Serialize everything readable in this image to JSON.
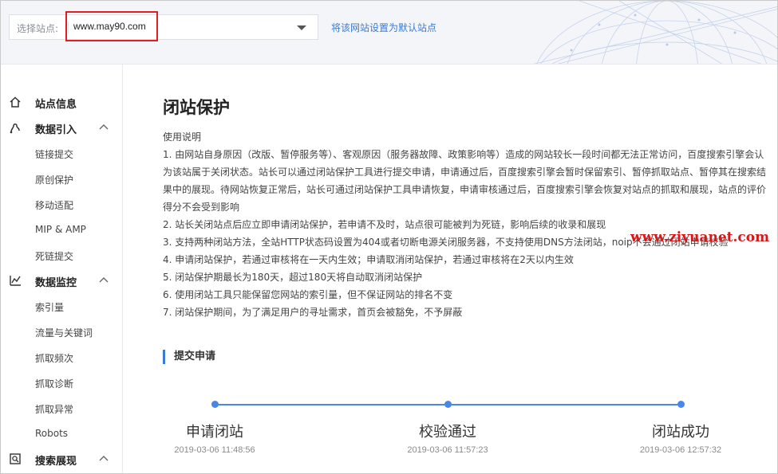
{
  "header": {
    "site_label": "选择站点:",
    "site_value": "www.may90.com",
    "default_link": "将该网站设置为默认站点"
  },
  "sidebar": {
    "items": [
      {
        "label": "站点信息",
        "icon": "home-icon"
      },
      {
        "label": "数据引入",
        "icon": "data-import-icon"
      },
      {
        "label": "数据监控",
        "icon": "chart-icon"
      },
      {
        "label": "搜索展现",
        "icon": "search-display-icon"
      }
    ],
    "sub_import": [
      "链接提交",
      "原创保护",
      "移动适配",
      "MIP & AMP",
      "死链提交"
    ],
    "sub_monitor": [
      "索引量",
      "流量与关键词",
      "抓取频次",
      "抓取诊断",
      "抓取异常",
      "Robots"
    ]
  },
  "main": {
    "title": "闭站保护",
    "usage_title": "使用说明",
    "rules": [
      "1. 由网站自身原因（改版、暂停服务等）、客观原因（服务器故障、政策影响等）造成的网站较长一段时间都无法正常访问，百度搜索引擎会认为该站属于关闭状态。站长可以通过闭站保护工具进行提交申请，申请通过后，百度搜索引擎会暂时保留索引、暂停抓取站点、暂停其在搜索结果中的展现。待网站恢复正常后，站长可通过闭站保护工具申请恢复，申请审核通过后，百度搜索引擎会恢复对站点的抓取和展现，站点的评价得分不会受到影响",
      "2. 站长关闭站点后应立即申请闭站保护，若申请不及时，站点很可能被判为死链，影响后续的收录和展现",
      "3. 支持两种闭站方法，全站HTTP状态码设置为404或者切断电源关闭服务器，不支持使用DNS方法闭站，noip不会通过闭站申请校验",
      "4. 申请闭站保护，若通过审核将在一天内生效；申请取消闭站保护，若通过审核将在2天以内生效",
      "5. 闭站保护期最长为180天，超过180天将自动取消闭站保护",
      "6. 使用闭站工具只能保留您网站的索引量，但不保证网站的排名不变",
      "7. 闭站保护期间，为了满足用户的寻址需求，首页会被豁免，不予屏蔽"
    ],
    "watermark": "www.ziyuanet.com",
    "section_title": "提交申请",
    "steps": [
      {
        "label": "申请闭站",
        "time": "2019-03-06 11:48:56"
      },
      {
        "label": "校验通过",
        "time": "2019-03-06 11:57:23"
      },
      {
        "label": "闭站成功",
        "time": "2019-03-06 12:57:32"
      }
    ]
  },
  "colors": {
    "accent": "#3a7bd5",
    "step_line": "#4a86e8",
    "highlight_box": "#e02020",
    "watermark": "#d81818"
  }
}
